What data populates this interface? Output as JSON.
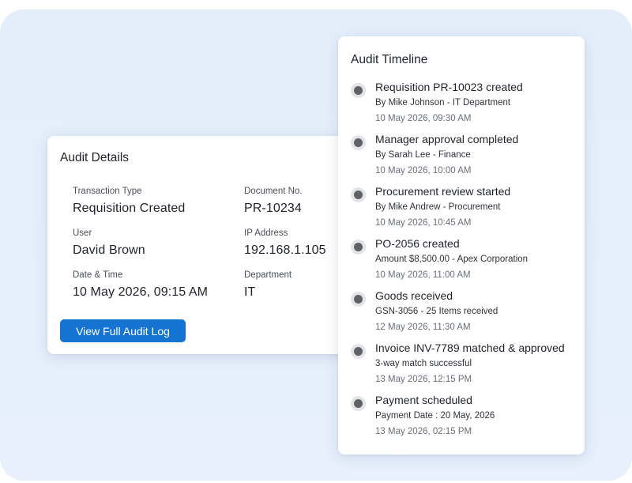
{
  "audit_details": {
    "title": "Audit Details",
    "fields": [
      {
        "label": "Transaction Type",
        "value": "Requisition Created"
      },
      {
        "label": "Document No.",
        "value": "PR-10234"
      },
      {
        "label": "User",
        "value": "David Brown"
      },
      {
        "label": "IP Address",
        "value": "192.168.1.105"
      },
      {
        "label": "Date & Time",
        "value": "10 May 2026, 09:15 AM"
      },
      {
        "label": "Department",
        "value": "IT"
      }
    ],
    "button_label": "View Full Audit Log",
    "button_color": "#1574d1"
  },
  "audit_timeline": {
    "title": "Audit Timeline",
    "events": [
      {
        "title": "Requisition PR-10023 created",
        "detail": "By  Mike Johnson - IT Department",
        "time": "10 May 2026, 09:30 AM"
      },
      {
        "title": "Manager approval completed",
        "detail": "By Sarah Lee - Finance",
        "time": "10 May 2026, 10:00 AM"
      },
      {
        "title": "Procurement review started",
        "detail": "By Mike Andrew - Procurement",
        "time": "10 May 2026, 10:45 AM"
      },
      {
        "title": "PO-2056 created",
        "detail": "Amount $8,500.00 - Apex Corporation",
        "time": "10 May 2026, 11:00 AM"
      },
      {
        "title": "Goods received",
        "detail": "GSN-3056 - 25 Items received",
        "time": "12 May 2026, 11:30 AM"
      },
      {
        "title": "Invoice INV-7789 matched & approved",
        "detail": "3-way match successful",
        "time": "13 May 2026, 12:15 PM"
      },
      {
        "title": "Payment scheduled",
        "detail": "Payment Date : 20 May, 2026",
        "time": "13 May 2026, 02:15 PM"
      }
    ],
    "dot_icon": "status-dot-icon"
  }
}
